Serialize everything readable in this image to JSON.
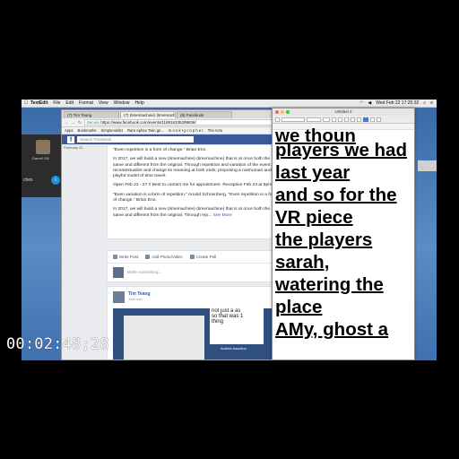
{
  "menubar": {
    "app": "TextEdit",
    "items": [
      "File",
      "Edit",
      "Format",
      "View",
      "Window",
      "Help"
    ],
    "clock": "Wed Feb 22  17:25:32"
  },
  "call_widget": {
    "caller": "Darrell Gill",
    "label": "ches"
  },
  "chrome": {
    "tabs": [
      "(7) Tim Teang",
      "(7) (timemachine) (timemach",
      "(8) Facebook"
    ],
    "secure_label": "Secure",
    "url": "https://www.facebook.com/events/11891633529983​6/",
    "bookmarks": [
      "Apps",
      "Bookmarks",
      "SimpleAddict",
      "Rare Aphex Twin ge...",
      "m o n k • p r o p h e t",
      "The Actu"
    ],
    "search_placeholder": "Search Facebook",
    "left_date": "February 21",
    "post_paragraphs": [
      "\"Even repetition is a form of change.\" Brian Eno.",
      "In 2017, we will build a new (timemachine) (timemachine) that is at once both the same and different from the original. Through repetition and variation of the event, to recontextualize and change its meaning at both ends, proposing a nonhuman and playful model of time travel.",
      "Open Feb 21 - 27 // Best to contact me for appointment. Reception Feb 23 at 8pm.",
      "\"Even variation is a form of repetition.\" Arnold Schoenberg. \"Even repetition is a form of change.\" Brian Eno.",
      "In 2017, we will build a new (timemachine) (timemachine) that is at once both the same and different from the original. Through rep..."
    ],
    "see_more": "See More",
    "composer": {
      "write_post": "Write Post",
      "add_photo": "Add Photo/Video",
      "create_poll": "Create Poll",
      "placeholder": "Write something..."
    },
    "post2": {
      "author": "Tim Teang",
      "time": "Just now",
      "shot_lines": [
        "not just a as",
        "so that was 1",
        "thing"
      ],
      "shot_caption": "Andrés Assolina"
    }
  },
  "textedit": {
    "title": "Untitled 2",
    "clipped_line": "we thoun",
    "lines": [
      "players we had",
      "last year",
      "and so for the",
      "VR piece",
      "the players",
      "sarah,",
      "watering the",
      "place",
      "AMy, ghost a"
    ]
  },
  "overlay": {
    "timecode": "00:02:48;28"
  }
}
